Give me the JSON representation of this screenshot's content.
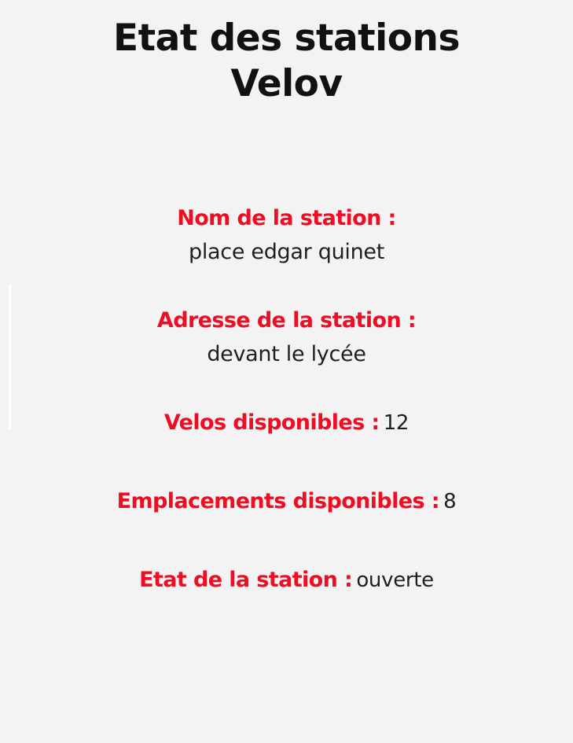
{
  "page": {
    "title_line1": "Etat des stations",
    "title_line2": "Velov"
  },
  "station": {
    "name_label": "Nom de la station :",
    "name_value": "place edgar quinet",
    "address_label": "Adresse de la station :",
    "address_value": "devant le lycée",
    "bikes_label": "Velos disponibles :",
    "bikes_value": "12",
    "slots_label": "Emplacements disponibles :",
    "slots_value": "8",
    "status_label": "Etat de la station :",
    "status_value": "ouverte"
  },
  "colors": {
    "background": "#f3f3f3",
    "label_red": "#ef0d24",
    "text_dark": "#1f1f1f"
  }
}
